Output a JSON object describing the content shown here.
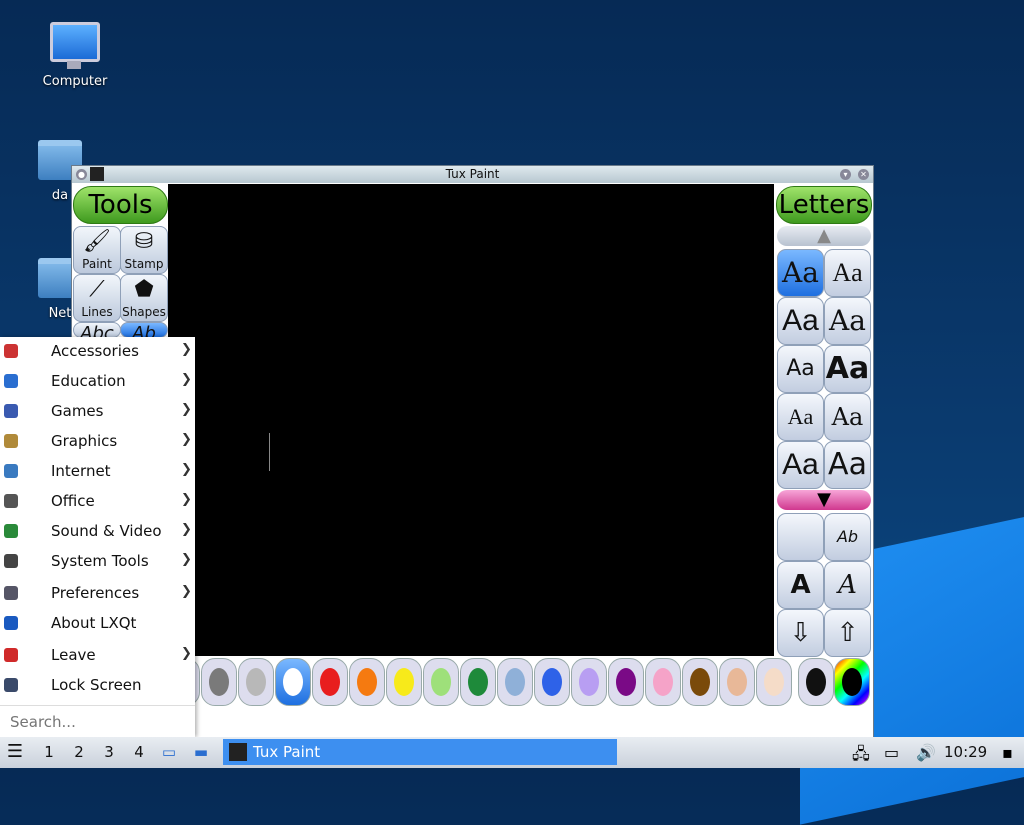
{
  "desktop": {
    "icons": [
      {
        "label": "Computer"
      },
      {
        "label": "da"
      },
      {
        "label": "Net"
      }
    ]
  },
  "window": {
    "title": "Tux Paint",
    "tools_header": "Tools",
    "letters_header": "Letters",
    "tools": [
      {
        "label": "Paint",
        "icon": "brush-icon"
      },
      {
        "label": "Stamp",
        "icon": "stamp-icon"
      },
      {
        "label": "Lines",
        "icon": "lines-icon"
      },
      {
        "label": "Shapes",
        "icon": "shapes-icon"
      },
      {
        "label": "Abc",
        "icon": "text-icon"
      },
      {
        "label": "Ab",
        "icon": "label-icon"
      }
    ],
    "font_sample": "Aa",
    "status_text": "!",
    "colors": [
      "#2b2b2b",
      "#7a7a7a",
      "#b8b8b8",
      "#ffffff",
      "#e81e1e",
      "#f57a10",
      "#f7ea1a",
      "#9ee07a",
      "#1e8a3a",
      "#8fb0d8",
      "#2e62e8",
      "#b89ef2",
      "#7a0a86",
      "#f5a3c8",
      "#7a4a0a",
      "#e8b898",
      "#f5dcc8"
    ]
  },
  "menu": {
    "items": [
      {
        "label": "Accessories",
        "submenu": true,
        "icon_color": "#c33"
      },
      {
        "label": "Education",
        "submenu": true,
        "icon_color": "#2a6ed0"
      },
      {
        "label": "Games",
        "submenu": true,
        "icon_color": "#3a5ab0"
      },
      {
        "label": "Graphics",
        "submenu": true,
        "icon_color": "#b08a3a"
      },
      {
        "label": "Internet",
        "submenu": true,
        "icon_color": "#3a7ac0"
      },
      {
        "label": "Office",
        "submenu": true,
        "icon_color": "#555"
      },
      {
        "label": "Sound & Video",
        "submenu": true,
        "icon_color": "#2a8a3a"
      },
      {
        "label": "System Tools",
        "submenu": true,
        "icon_color": "#444"
      },
      {
        "label": "Preferences",
        "submenu": true,
        "icon_color": "#556"
      },
      {
        "label": "About LXQt",
        "submenu": false,
        "icon_color": "#1a5ac0"
      },
      {
        "label": "Leave",
        "submenu": true,
        "icon_color": "#d02a2a"
      },
      {
        "label": "Lock Screen",
        "submenu": false,
        "icon_color": "#3a4a6a"
      }
    ],
    "search_placeholder": "Search..."
  },
  "taskbar": {
    "workspaces": [
      "1",
      "2",
      "3",
      "4"
    ],
    "task_label": "Tux Paint",
    "clock": "10:29"
  }
}
